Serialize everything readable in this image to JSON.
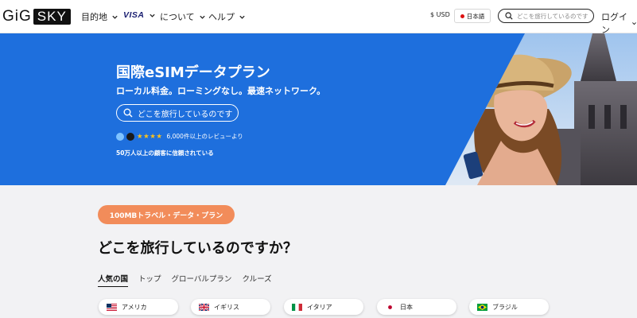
{
  "header": {
    "logo": {
      "left": "GiG",
      "right": "SKY"
    },
    "nav": [
      {
        "label": "目的地"
      },
      {
        "label": "VISA"
      },
      {
        "label": "について"
      },
      {
        "label": "ヘルプ"
      }
    ],
    "currency": "$ USD",
    "language": "日本語",
    "search_placeholder": "どこを旅行しているのです",
    "login": "ログイン"
  },
  "hero": {
    "title": "国際eSIMデータプラン",
    "subtitle": "ローカル料金。ローミングなし。最速ネットワーク。",
    "search_placeholder": "どこを旅行しているのです",
    "stars": "★★★★",
    "reviews": "6,000件以上のレビューより",
    "trust": "50万人以上の顧客に信頼されている"
  },
  "promo": {
    "label": "100MBトラベル・データ・プラン"
  },
  "question": "どこを旅行しているのですか？",
  "tabs": [
    {
      "label": "人気の国",
      "active": true
    },
    {
      "label": "トップ",
      "active": false
    },
    {
      "label": "グローバルプラン",
      "active": false
    },
    {
      "label": "クルーズ",
      "active": false
    }
  ],
  "countries": [
    {
      "label": "アメリカ",
      "flag": "us-flag"
    },
    {
      "label": "イギリス",
      "flag": "uk-flag"
    },
    {
      "label": "イタリア",
      "flag": "italy-flag"
    },
    {
      "label": "日本",
      "flag": "japan-flag"
    },
    {
      "label": "ブラジル",
      "flag": "brazil-flag"
    }
  ],
  "colors": {
    "hero_blue": "#1e6fdd",
    "promo_orange": "#f28c5a",
    "star_yellow": "#ffc21a"
  }
}
